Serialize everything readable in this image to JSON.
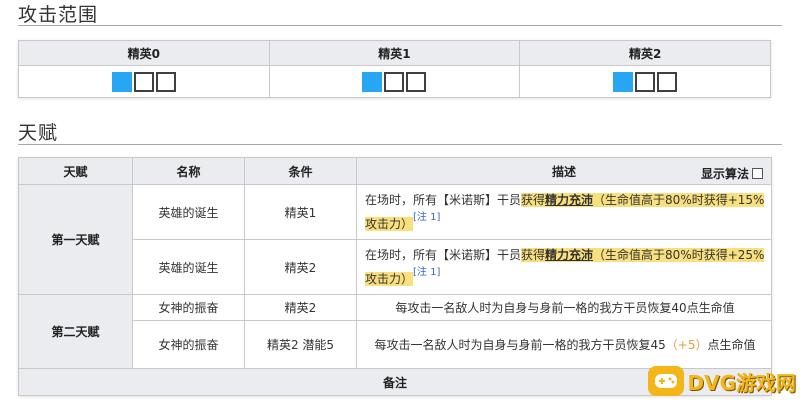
{
  "range_section": {
    "title": "攻击范围",
    "columns": [
      {
        "label": "精英0",
        "cells": [
          true,
          false,
          false
        ]
      },
      {
        "label": "精英1",
        "cells": [
          true,
          false,
          false
        ]
      },
      {
        "label": "精英2",
        "cells": [
          true,
          false,
          false
        ]
      }
    ]
  },
  "talent_section": {
    "title": "天赋",
    "headers": {
      "talent": "天赋",
      "name": "名称",
      "condition": "条件",
      "description": "描述",
      "show_algo": "显示算法"
    },
    "groups": [
      {
        "label": "第一天赋",
        "rows": [
          {
            "name": "英雄的诞生",
            "condition": "精英1",
            "desc_prefix": "在场时，所有【米诺斯】干员",
            "desc_hl_a": "获得",
            "desc_hl_bold": "精力充沛",
            "desc_hl_b": "（生命值高于80%时获得+15%攻击力）",
            "note": "[注 1]"
          },
          {
            "name": "英雄的诞生",
            "condition": "精英2",
            "desc_prefix": "在场时，所有【米诺斯】干员",
            "desc_hl_a": "获得",
            "desc_hl_bold": "精力充沛",
            "desc_hl_b": "（生命值高于80%时获得+25%攻击力）",
            "note": "[注 1]"
          }
        ]
      },
      {
        "label": "第二天赋",
        "rows": [
          {
            "name": "女神的振奋",
            "condition": "精英2",
            "desc": "每攻击一名敌人时为自身与身前一格的我方干员恢复40点生命值"
          },
          {
            "name": "女神的振奋",
            "condition": "精英2 潜能5",
            "desc_a": "每攻击一名敌人时为自身与身前一格的我方干员恢复45",
            "desc_plus": "（+5）",
            "desc_b": "点生命值"
          }
        ]
      }
    ],
    "footer": "备注"
  },
  "watermark": {
    "text": "DVG游戏网"
  }
}
